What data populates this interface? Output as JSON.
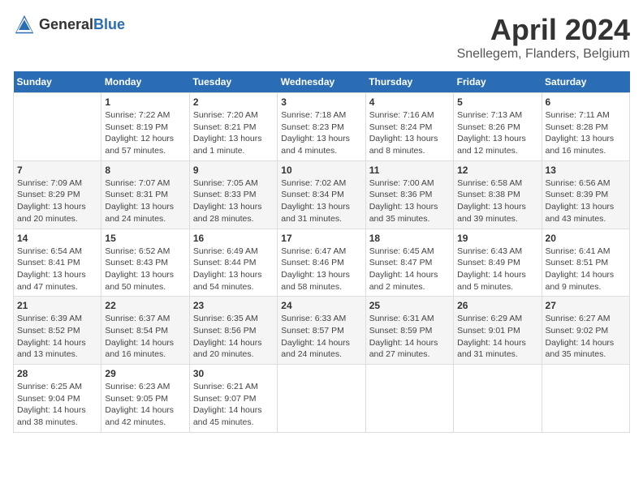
{
  "logo": {
    "general": "General",
    "blue": "Blue"
  },
  "title": "April 2024",
  "location": "Snellegem, Flanders, Belgium",
  "days_header": [
    "Sunday",
    "Monday",
    "Tuesday",
    "Wednesday",
    "Thursday",
    "Friday",
    "Saturday"
  ],
  "weeks": [
    [
      {
        "day": "",
        "info": ""
      },
      {
        "day": "1",
        "info": "Sunrise: 7:22 AM\nSunset: 8:19 PM\nDaylight: 12 hours and 57 minutes."
      },
      {
        "day": "2",
        "info": "Sunrise: 7:20 AM\nSunset: 8:21 PM\nDaylight: 13 hours and 1 minute."
      },
      {
        "day": "3",
        "info": "Sunrise: 7:18 AM\nSunset: 8:23 PM\nDaylight: 13 hours and 4 minutes."
      },
      {
        "day": "4",
        "info": "Sunrise: 7:16 AM\nSunset: 8:24 PM\nDaylight: 13 hours and 8 minutes."
      },
      {
        "day": "5",
        "info": "Sunrise: 7:13 AM\nSunset: 8:26 PM\nDaylight: 13 hours and 12 minutes."
      },
      {
        "day": "6",
        "info": "Sunrise: 7:11 AM\nSunset: 8:28 PM\nDaylight: 13 hours and 16 minutes."
      }
    ],
    [
      {
        "day": "7",
        "info": "Sunrise: 7:09 AM\nSunset: 8:29 PM\nDaylight: 13 hours and 20 minutes."
      },
      {
        "day": "8",
        "info": "Sunrise: 7:07 AM\nSunset: 8:31 PM\nDaylight: 13 hours and 24 minutes."
      },
      {
        "day": "9",
        "info": "Sunrise: 7:05 AM\nSunset: 8:33 PM\nDaylight: 13 hours and 28 minutes."
      },
      {
        "day": "10",
        "info": "Sunrise: 7:02 AM\nSunset: 8:34 PM\nDaylight: 13 hours and 31 minutes."
      },
      {
        "day": "11",
        "info": "Sunrise: 7:00 AM\nSunset: 8:36 PM\nDaylight: 13 hours and 35 minutes."
      },
      {
        "day": "12",
        "info": "Sunrise: 6:58 AM\nSunset: 8:38 PM\nDaylight: 13 hours and 39 minutes."
      },
      {
        "day": "13",
        "info": "Sunrise: 6:56 AM\nSunset: 8:39 PM\nDaylight: 13 hours and 43 minutes."
      }
    ],
    [
      {
        "day": "14",
        "info": "Sunrise: 6:54 AM\nSunset: 8:41 PM\nDaylight: 13 hours and 47 minutes."
      },
      {
        "day": "15",
        "info": "Sunrise: 6:52 AM\nSunset: 8:43 PM\nDaylight: 13 hours and 50 minutes."
      },
      {
        "day": "16",
        "info": "Sunrise: 6:49 AM\nSunset: 8:44 PM\nDaylight: 13 hours and 54 minutes."
      },
      {
        "day": "17",
        "info": "Sunrise: 6:47 AM\nSunset: 8:46 PM\nDaylight: 13 hours and 58 minutes."
      },
      {
        "day": "18",
        "info": "Sunrise: 6:45 AM\nSunset: 8:47 PM\nDaylight: 14 hours and 2 minutes."
      },
      {
        "day": "19",
        "info": "Sunrise: 6:43 AM\nSunset: 8:49 PM\nDaylight: 14 hours and 5 minutes."
      },
      {
        "day": "20",
        "info": "Sunrise: 6:41 AM\nSunset: 8:51 PM\nDaylight: 14 hours and 9 minutes."
      }
    ],
    [
      {
        "day": "21",
        "info": "Sunrise: 6:39 AM\nSunset: 8:52 PM\nDaylight: 14 hours and 13 minutes."
      },
      {
        "day": "22",
        "info": "Sunrise: 6:37 AM\nSunset: 8:54 PM\nDaylight: 14 hours and 16 minutes."
      },
      {
        "day": "23",
        "info": "Sunrise: 6:35 AM\nSunset: 8:56 PM\nDaylight: 14 hours and 20 minutes."
      },
      {
        "day": "24",
        "info": "Sunrise: 6:33 AM\nSunset: 8:57 PM\nDaylight: 14 hours and 24 minutes."
      },
      {
        "day": "25",
        "info": "Sunrise: 6:31 AM\nSunset: 8:59 PM\nDaylight: 14 hours and 27 minutes."
      },
      {
        "day": "26",
        "info": "Sunrise: 6:29 AM\nSunset: 9:01 PM\nDaylight: 14 hours and 31 minutes."
      },
      {
        "day": "27",
        "info": "Sunrise: 6:27 AM\nSunset: 9:02 PM\nDaylight: 14 hours and 35 minutes."
      }
    ],
    [
      {
        "day": "28",
        "info": "Sunrise: 6:25 AM\nSunset: 9:04 PM\nDaylight: 14 hours and 38 minutes."
      },
      {
        "day": "29",
        "info": "Sunrise: 6:23 AM\nSunset: 9:05 PM\nDaylight: 14 hours and 42 minutes."
      },
      {
        "day": "30",
        "info": "Sunrise: 6:21 AM\nSunset: 9:07 PM\nDaylight: 14 hours and 45 minutes."
      },
      {
        "day": "",
        "info": ""
      },
      {
        "day": "",
        "info": ""
      },
      {
        "day": "",
        "info": ""
      },
      {
        "day": "",
        "info": ""
      }
    ]
  ]
}
